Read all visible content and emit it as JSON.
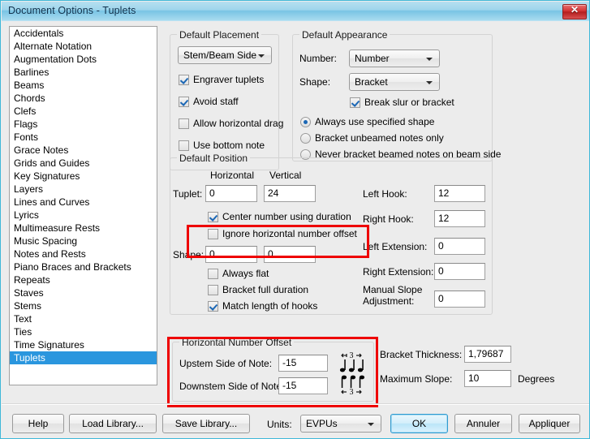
{
  "window": {
    "title": "Document Options - Tuplets",
    "close_label": "✕"
  },
  "categories": {
    "items": [
      "Accidentals",
      "Alternate Notation",
      "Augmentation Dots",
      "Barlines",
      "Beams",
      "Chords",
      "Clefs",
      "Flags",
      "Fonts",
      "Grace Notes",
      "Grids and Guides",
      "Key Signatures",
      "Layers",
      "Lines and Curves",
      "Lyrics",
      "Multimeasure Rests",
      "Music Spacing",
      "Notes and Rests",
      "Piano Braces and Brackets",
      "Repeats",
      "Staves",
      "Stems",
      "Text",
      "Ties",
      "Time Signatures",
      "Tuplets"
    ],
    "selected": "Tuplets",
    "selected_index": 25
  },
  "default_placement": {
    "legend": "Default Placement",
    "placement_value": "Stem/Beam Side",
    "checkboxes": [
      {
        "label": "Engraver tuplets",
        "checked": true
      },
      {
        "label": "Avoid staff",
        "checked": true
      },
      {
        "label": "Allow horizontal drag",
        "checked": false
      },
      {
        "label": "Use bottom note",
        "checked": false
      }
    ]
  },
  "default_appearance": {
    "legend": "Default Appearance",
    "number_label": "Number:",
    "number_value": "Number",
    "shape_label": "Shape:",
    "shape_value": "Bracket",
    "break_slur": {
      "label": "Break slur or bracket",
      "checked": true
    },
    "radios": [
      {
        "label": "Always use specified shape",
        "checked": true
      },
      {
        "label": "Bracket unbeamed notes only",
        "checked": false
      },
      {
        "label": "Never bracket beamed notes on beam side",
        "checked": false
      }
    ]
  },
  "default_position": {
    "legend": "Default Position",
    "col_horizontal": "Horizontal",
    "col_vertical": "Vertical",
    "tuplet_label": "Tuplet:",
    "tuplet_horizontal": "0",
    "tuplet_vertical": "24",
    "center_number": {
      "label": "Center number using duration",
      "checked": true
    },
    "ignore_offset": {
      "label": "Ignore horizontal number offset",
      "checked": false
    },
    "shape_label": "Shape:",
    "shape_horizontal": "0",
    "shape_vertical": "0",
    "always_flat": {
      "label": "Always flat",
      "checked": false
    },
    "bracket_full_duration": {
      "label": "Bracket full duration",
      "checked": false
    },
    "match_hooks": {
      "label": "Match length of hooks",
      "checked": true
    },
    "left_hook_label": "Left Hook:",
    "left_hook_value": "12",
    "right_hook_label": "Right Hook:",
    "right_hook_value": "12",
    "left_extension_label": "Left Extension:",
    "left_extension_value": "0",
    "right_extension_label": "Right Extension:",
    "right_extension_value": "0",
    "manual_slope_label_1": "Manual Slope",
    "manual_slope_label_2": "Adjustment:",
    "manual_slope_value": "0"
  },
  "horizontal_number_offset": {
    "legend": "Horizontal Number Offset",
    "upstem_label": "Upstem Side of Note:",
    "upstem_value": "-15",
    "downstem_label": "Downstem Side of Note:",
    "downstem_value": "-15",
    "upstem_figure_name": "tuplet-3-upstem-notes-figure",
    "downstem_figure_name": "tuplet-3-downstem-notes-figure"
  },
  "bracket_settings": {
    "thickness_label": "Bracket Thickness:",
    "thickness_value": "1,79687",
    "max_slope_label": "Maximum Slope:",
    "max_slope_value": "10",
    "degrees_label": "Degrees"
  },
  "footer": {
    "help_label": "Help",
    "load_library_label": "Load Library...",
    "save_library_label": "Save Library...",
    "units_label": "Units:",
    "units_value": "EVPUs",
    "ok_label": "OK",
    "cancel_label": "Annuler",
    "apply_label": "Appliquer"
  },
  "colors": {
    "titlebar_accent": "#79c4e4",
    "selection": "#2a96de",
    "highlight_box": "#ee0000",
    "dialog_bg": "#ececec",
    "close_button": "#d23232"
  }
}
